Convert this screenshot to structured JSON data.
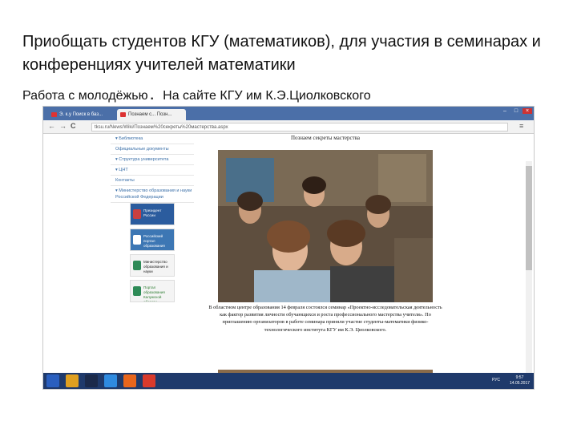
{
  "slide": {
    "title": "Приобщать студентов КГУ (математиков), для участия в семинарах и конференциях учителей математики",
    "subtitle_left": "Работа с молодёжью",
    "subtitle_dot": ".",
    "subtitle_right": "На сайте КГУ им К.Э.Циолковского"
  },
  "browser": {
    "tabs": [
      {
        "label": "Э. к.у Поиск в баз..."
      },
      {
        "label": "Познаем с... Позн..."
      }
    ],
    "window_controls": [
      "–",
      "□",
      "×"
    ],
    "nav_icons": [
      "arrow-left-icon",
      "arrow-right-icon",
      "reload-icon"
    ],
    "nav_glyphs": [
      "←",
      "→",
      "C"
    ],
    "url": "tksu.ru/News/Wiki/Познаем%20секреты%20мастерства.aspx",
    "menu_glyph": "≡"
  },
  "sidebar": {
    "items": [
      "▾ Библиотека",
      "Официальные документы",
      "▾ Структура университета",
      "▾ ЦНТ",
      "Контакты",
      "▾ Министерство образования и науки Российской Федерации"
    ],
    "banners": [
      {
        "label": "Президент России"
      },
      {
        "label": "Российский портал образования"
      },
      {
        "label": "Министерство образования и науки"
      },
      {
        "label": "Портал образования Калужской области"
      }
    ]
  },
  "article": {
    "title": "Познаем секреты мастерства",
    "body": "В областном центре образования 14 февраля состоялся семинар «Проектно-исследовательская деятельность как фактор развития личности обучающихся и роста профессионального мастерства учителя». По приглашению организаторов в работе семинара приняли участие студенты-математики физико-технологического института КГУ им К.Э. Циолковского."
  },
  "taskbar": {
    "apps": [
      "windows-icon",
      "explorer-icon",
      "photoshop-icon",
      "ie-icon",
      "firefox-icon",
      "chrome-icon"
    ],
    "colors": [
      "#2a5fbf",
      "#e0a020",
      "#1b2a4a",
      "#2f8be0",
      "#e8661c",
      "#d93a2b"
    ],
    "language": "РУС",
    "time": "9:57",
    "date": "14.05.2017"
  }
}
